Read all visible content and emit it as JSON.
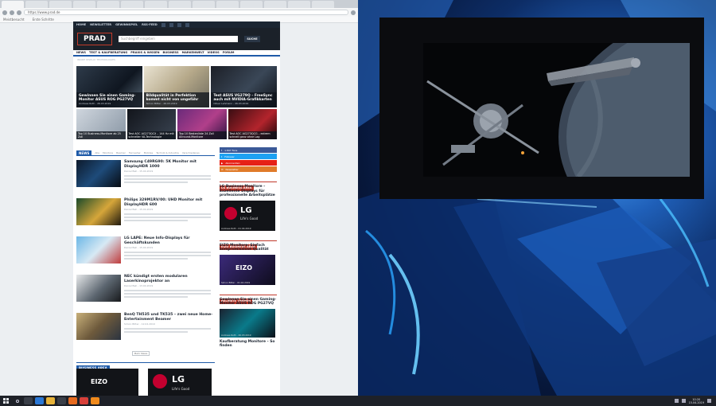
{
  "browser": {
    "url": "https://www.prad.de",
    "bookmarks": [
      "Meistbesucht",
      "Erste Schritte"
    ]
  },
  "site": {
    "topbar": [
      "HOME",
      "NEWSLETTER",
      "GEWINNSPIEL",
      "RSS-FEED"
    ],
    "logo": "PRAD",
    "logo_sub": "INSIDE DISPLAY TECHNOLOGIES",
    "search_placeholder": "Suchbegriff eingeben",
    "search_button": "SUCHE",
    "menu": [
      "NEWS",
      "TEST & KAUFBERATUNG",
      "PRAXIS & WISSEN",
      "BUSINESS",
      "MARKENWELT",
      "VIDEOS",
      "FORUM"
    ],
    "hero": [
      {
        "title": "Gewinnen Sie einen Gaming-Monitor ASUS ROG PG27VQ",
        "meta": "Andreas Roth - 26.03.2019"
      },
      {
        "title": "Bildqualität in Perfektion kommt nicht von ungefähr",
        "meta": "Simon Bitter - 26.03.2019"
      },
      {
        "title": "Test ASUS VG279Q – FreeSync auch mit NVIDIA-Grafikkarten",
        "meta": "Oliver Lehmann - 26.03.2019"
      }
    ],
    "minis": [
      "Top 10 Business-Monitore ab 25 Zoll",
      "Test AOC AG273QCX – 144 Hz mit schneller VA-Technologie",
      "Top 10 Bestenliste 24 Zoll Allround-Monitore",
      "Test AOC AG273QCG – extrem schnell ganz ohne Lag"
    ],
    "news_label": "NEWS",
    "news_tabs": [
      "Alle",
      "Monitore",
      "Beamer",
      "Fernseher",
      "Mobiles",
      "Technik & Industrie",
      "Verschiedenes"
    ],
    "news": [
      {
        "title": "Samsung C49RG90: 5K Monitor mit DisplayHDR 1000",
        "meta": "Daniel Bell - 15.04.2019"
      },
      {
        "title": "Philips 329M1RV/00: UHD Monitor mit DisplayHDR 600",
        "meta": "Daniel Bell - 15.04.2019"
      },
      {
        "title": "LG LAPE: Neue Info-Displays für Geschäftskunden",
        "meta": "Daniel Bell - 15.04.2019"
      },
      {
        "title": "NEC kündigt ersten modularen Laserkinoprojektor an",
        "meta": "Daniel Bell - 13.04.2019"
      },
      {
        "title": "BenQ TH535 und TK535 – zwei neue Home-Entertainment Beamer",
        "meta": "Simon Bitter - 12.04.2019"
      }
    ],
    "more_button": "Mehr News",
    "business_label": "BUSINESS AREA",
    "business_tiles": [
      "EIZO",
      "LG"
    ],
    "business_tile_sub": "Life's Good",
    "social": [
      {
        "label": "f",
        "text": "1.897 Fans",
        "color": "#3b5998"
      },
      {
        "label": "t",
        "text": "Follower",
        "color": "#1da1f2"
      },
      {
        "label": "▶",
        "text": "Abonnenten",
        "color": "#e62117"
      },
      {
        "label": "✉",
        "text": "Newsletter",
        "color": "#e07b2a"
      }
    ],
    "side": [
      {
        "head": "LG BUSINESS AREA",
        "title": "LG Business Monitore – Exzellente Displays für professionelle Arbeitsplätze",
        "ad": "LG",
        "ad_sub": "Life's Good",
        "meta": "Andreas Roth - 01.04.2019"
      },
      {
        "head": "EIZO BUSINESS AREA",
        "title": "EIZO Monitore: Einfach kompromisslose Qualität",
        "ad": "EIZO",
        "ad_sub": "",
        "meta": "Simon Bitter - 01.04.2019"
      },
      {
        "head": "BELIEBTE THEMEN",
        "title": "Gewinnen Sie einen Gaming-Monitor ASUS ROG PG27VQ",
        "ad": "",
        "ad_sub": "",
        "meta": "Andreas Roth - 26.03.2019"
      }
    ],
    "side_last": "Kaufberatung Monitore – So finden"
  },
  "taskbar": {
    "time": "10:20",
    "date": "15.04.2019"
  }
}
